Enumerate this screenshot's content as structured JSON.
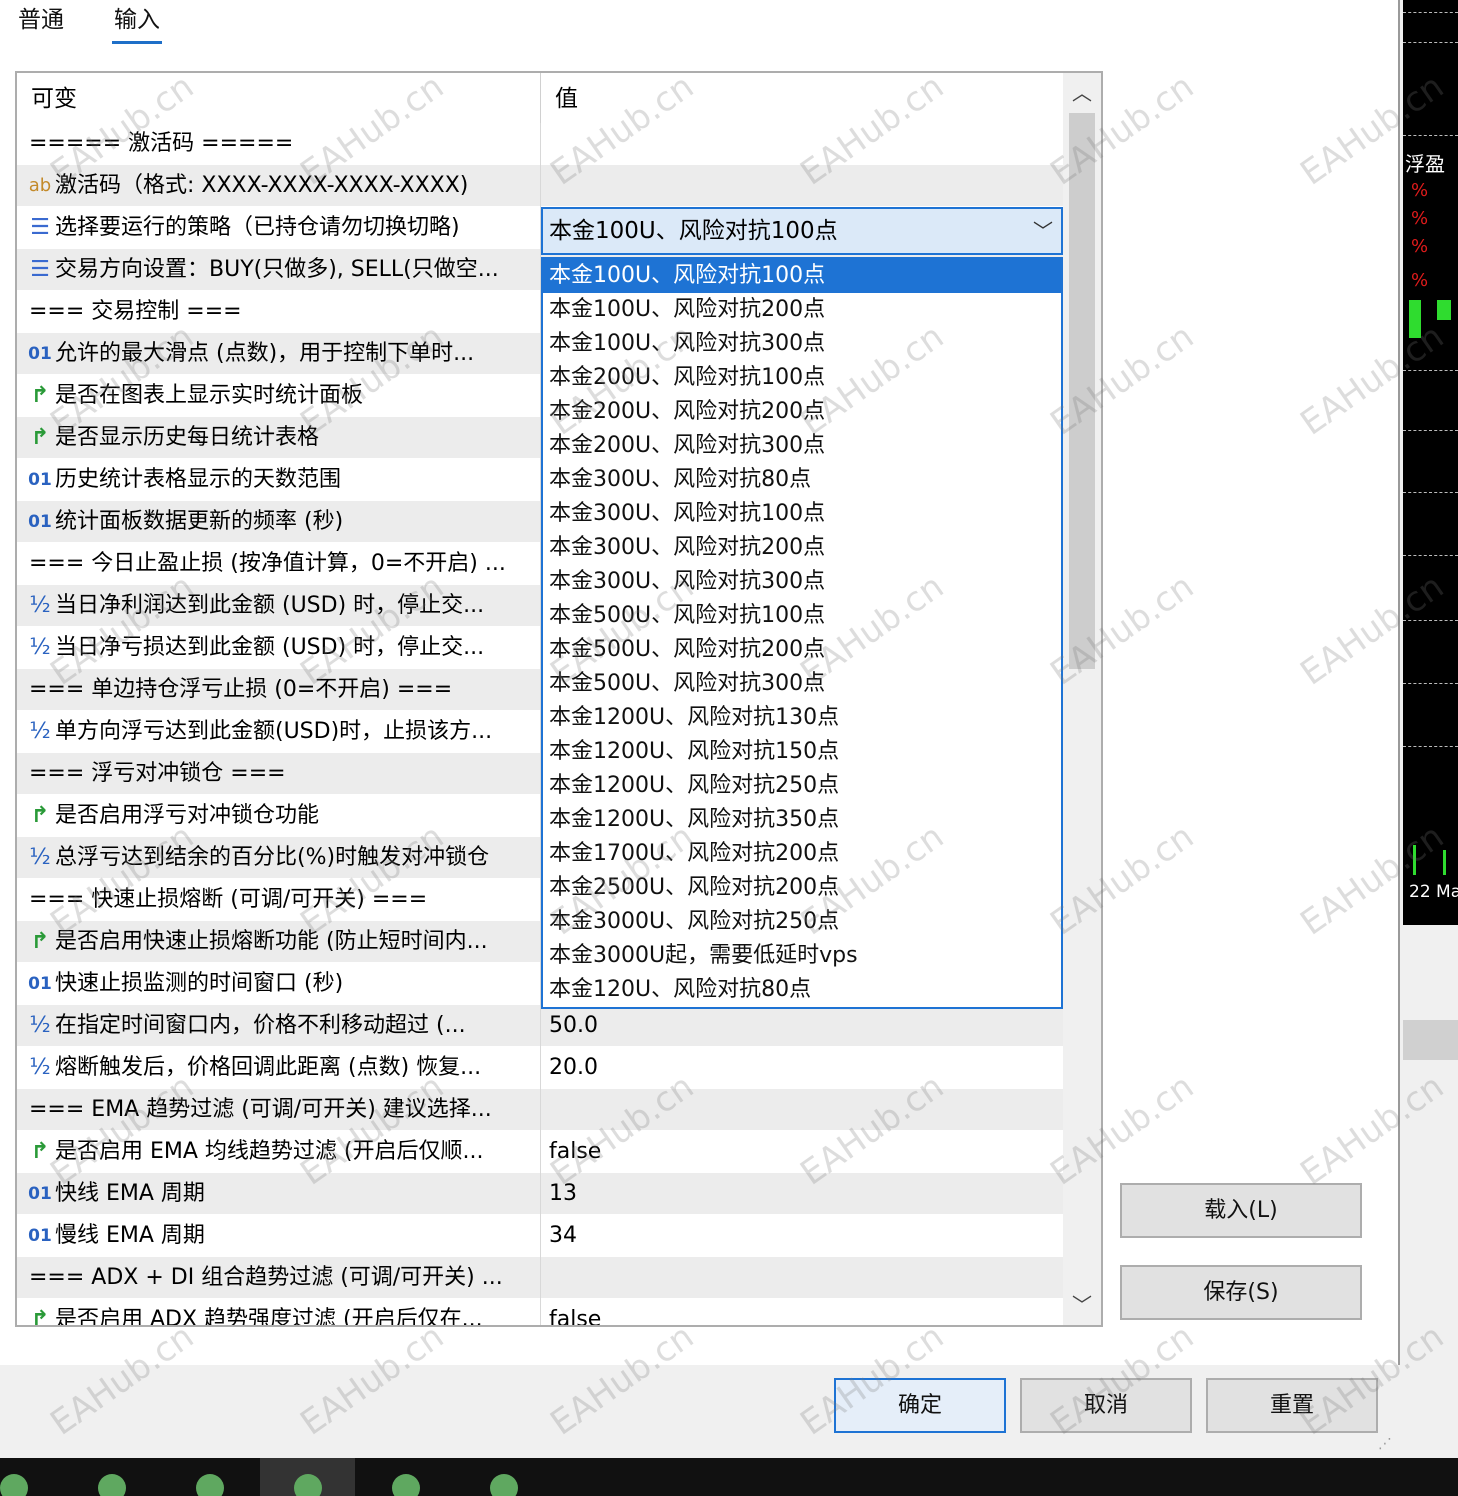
{
  "tabs": {
    "general": "普通",
    "inputs": "输入"
  },
  "grid": {
    "header_variable": "可变",
    "header_value": "值",
    "rows": [
      {
        "icon": "none",
        "name": "===== 激活码 =====",
        "value": ""
      },
      {
        "icon": "ab",
        "name": "激活码（格式: XXXX-XXXX-XXXX-XXXX)",
        "value": ""
      },
      {
        "icon": "enum",
        "name": "选择要运行的策略（已持仓请勿切换切略)",
        "value": ""
      },
      {
        "icon": "enum",
        "name": "交易方向设置：BUY(只做多), SELL(只做空...",
        "value": ""
      },
      {
        "icon": "none",
        "name": "=== 交易控制 ===",
        "value": ""
      },
      {
        "icon": "01",
        "name": "允许的最大滑点 (点数)，用于控制下单时...",
        "value": ""
      },
      {
        "icon": "bool",
        "name": "是否在图表上显示实时统计面板",
        "value": ""
      },
      {
        "icon": "bool",
        "name": "是否显示历史每日统计表格",
        "value": ""
      },
      {
        "icon": "01",
        "name": "历史统计表格显示的天数范围",
        "value": ""
      },
      {
        "icon": "01",
        "name": "统计面板数据更新的频率 (秒)",
        "value": ""
      },
      {
        "icon": "none",
        "name": "=== 今日止盈止损 (按净值计算，0=不开启) ...",
        "value": ""
      },
      {
        "icon": "half",
        "name": "当日净利润达到此金额 (USD) 时，停止交...",
        "value": ""
      },
      {
        "icon": "half",
        "name": "当日净亏损达到此金额 (USD) 时，停止交...",
        "value": ""
      },
      {
        "icon": "none",
        "name": "=== 单边持仓浮亏止损 (0=不开启) ===",
        "value": ""
      },
      {
        "icon": "half",
        "name": "单方向浮亏达到此金额(USD)时，止损该方...",
        "value": ""
      },
      {
        "icon": "none",
        "name": "=== 浮亏对冲锁仓 ===",
        "value": ""
      },
      {
        "icon": "bool",
        "name": "是否启用浮亏对冲锁仓功能",
        "value": ""
      },
      {
        "icon": "half",
        "name": "总浮亏达到结余的百分比(%)时触发对冲锁仓",
        "value": ""
      },
      {
        "icon": "none",
        "name": "=== 快速止损熔断 (可调/可开关) ===",
        "value": ""
      },
      {
        "icon": "bool",
        "name": "是否启用快速止损熔断功能 (防止短时间内...",
        "value": ""
      },
      {
        "icon": "01",
        "name": "快速止损监测的时间窗口 (秒)",
        "value": ""
      },
      {
        "icon": "half",
        "name": "在指定时间窗口内，价格不利移动超过 (...",
        "value": "50.0"
      },
      {
        "icon": "half",
        "name": "熔断触发后，价格回调此距离 (点数) 恢复...",
        "value": "20.0"
      },
      {
        "icon": "none",
        "name": "=== EMA 趋势过滤 (可调/可开关) 建议选择...",
        "value": ""
      },
      {
        "icon": "bool",
        "name": "是否启用 EMA 均线趋势过滤 (开启后仅顺...",
        "value": "false"
      },
      {
        "icon": "01",
        "name": "快线 EMA 周期",
        "value": "13"
      },
      {
        "icon": "01",
        "name": "慢线 EMA 周期",
        "value": "34"
      },
      {
        "icon": "none",
        "name": "=== ADX + DI 组合趋势过滤 (可调/可开关) ...",
        "value": ""
      },
      {
        "icon": "bool",
        "name": "是否启用 ADX 趋势强度过滤 (开启后仅在...",
        "value": "false"
      }
    ]
  },
  "icons": {
    "none": "",
    "ab": "ab",
    "enum": "☰",
    "01": "01",
    "bool": "↱",
    "half": "½"
  },
  "combo": {
    "selected": "本金100U、风险对抗100点",
    "options": [
      "本金100U、风险对抗100点",
      "本金100U、风险对抗200点",
      "本金100U、风险对抗300点",
      "本金200U、风险对抗100点",
      "本金200U、风险对抗200点",
      "本金200U、风险对抗300点",
      "本金300U、风险对抗80点",
      "本金300U、风险对抗100点",
      "本金300U、风险对抗200点",
      "本金300U、风险对抗300点",
      "本金500U、风险对抗100点",
      "本金500U、风险对抗200点",
      "本金500U、风险对抗300点",
      "本金1200U、风险对抗130点",
      "本金1200U、风险对抗150点",
      "本金1200U、风险对抗250点",
      "本金1200U、风险对抗350点",
      "本金1700U、风险对抗200点",
      "本金2500U、风险对抗200点",
      "本金3000U、风险对抗250点",
      "本金3000U起，需要低延时vps",
      "本金120U、风险对抗80点"
    ]
  },
  "buttons": {
    "load": "载入(L)",
    "save": "保存(S)",
    "ok": "确定",
    "cancel": "取消",
    "reset": "重置"
  },
  "chart": {
    "label": "浮盈",
    "percent": "%",
    "date": "22 Ma"
  },
  "watermark": "EAHub.cn",
  "colors": {
    "accent": "#1e73d4",
    "bool_icon": "#2a9a38",
    "num_icon": "#2a62c0",
    "string_icon": "#c38a2a",
    "chart_bg": "#000000",
    "chart_percent": "#e01b1b"
  }
}
